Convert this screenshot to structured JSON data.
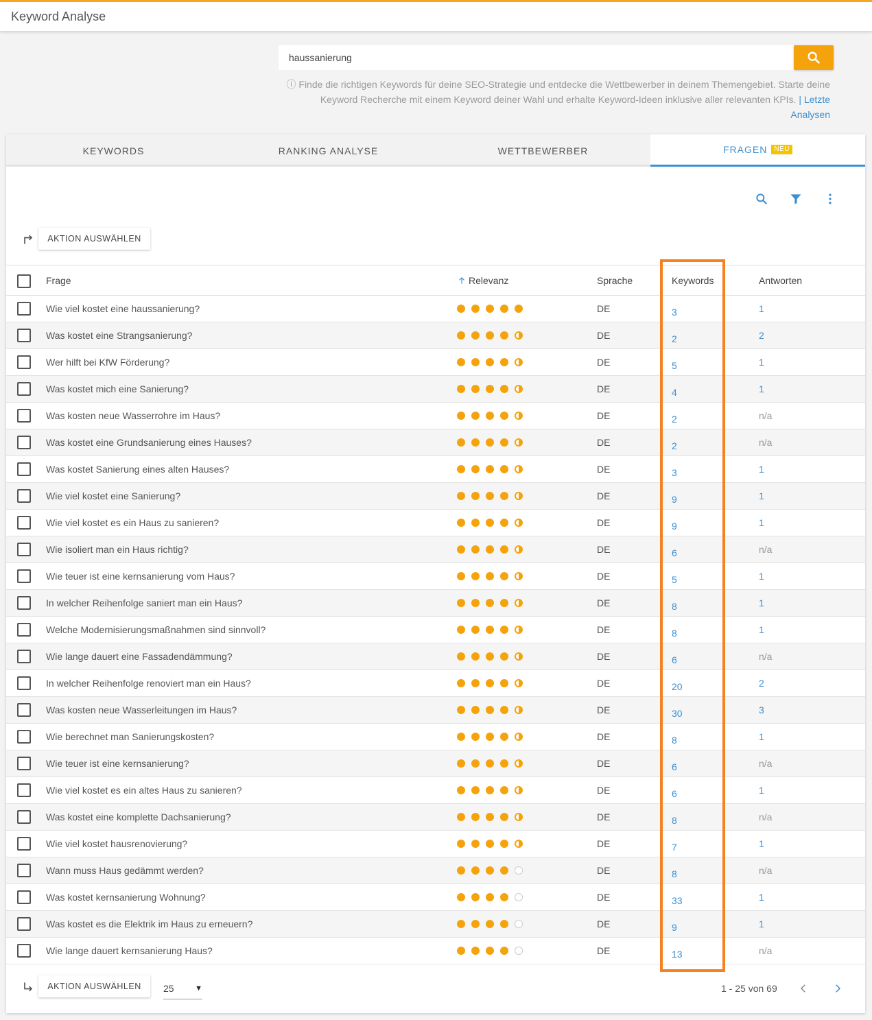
{
  "app": {
    "title": "Keyword Analyse"
  },
  "search": {
    "value": "haussanierung",
    "hint": "ⓘ Finde die richtigen Keywords für deine SEO-Strategie und entdecke die Wettbewerber in deinem Themengebiet. Starte deine Keyword Recherche mit einem Keyword deiner Wahl und erhalte Keyword-Ideen inklusive aller relevanten KPIs.",
    "hint_link": "| Letzte Analysen"
  },
  "tabs": [
    {
      "label": "KEYWORDS"
    },
    {
      "label": "RANKING ANALYSE"
    },
    {
      "label": "WETTBEWERBER"
    },
    {
      "label": "FRAGEN",
      "badge": "NEU",
      "active": true
    }
  ],
  "toolbar": {
    "action_label": "AKTION AUSWÄHLEN"
  },
  "table": {
    "headers": {
      "frage": "Frage",
      "relevanz": "Relevanz",
      "sprache": "Sprache",
      "keywords": "Keywords",
      "antworten": "Antworten"
    },
    "rows": [
      {
        "frage": "Wie viel kostet eine haussanierung?",
        "relevance": 5,
        "sprache": "DE",
        "keywords": "3",
        "antworten": "1"
      },
      {
        "frage": "Was kostet eine Strangsanierung?",
        "relevance": 4.5,
        "sprache": "DE",
        "keywords": "2",
        "antworten": "2"
      },
      {
        "frage": "Wer hilft bei KfW Förderung?",
        "relevance": 4.5,
        "sprache": "DE",
        "keywords": "5",
        "antworten": "1"
      },
      {
        "frage": "Was kostet mich eine Sanierung?",
        "relevance": 4.5,
        "sprache": "DE",
        "keywords": "4",
        "antworten": "1"
      },
      {
        "frage": "Was kosten neue Wasserrohre im Haus?",
        "relevance": 4.5,
        "sprache": "DE",
        "keywords": "2",
        "antworten": "n/a"
      },
      {
        "frage": "Was kostet eine Grundsanierung eines Hauses?",
        "relevance": 4.5,
        "sprache": "DE",
        "keywords": "2",
        "antworten": "n/a"
      },
      {
        "frage": "Was kostet Sanierung eines alten Hauses?",
        "relevance": 4.5,
        "sprache": "DE",
        "keywords": "3",
        "antworten": "1"
      },
      {
        "frage": "Wie viel kostet eine Sanierung?",
        "relevance": 4.5,
        "sprache": "DE",
        "keywords": "9",
        "antworten": "1"
      },
      {
        "frage": "Wie viel kostet es ein Haus zu sanieren?",
        "relevance": 4.5,
        "sprache": "DE",
        "keywords": "9",
        "antworten": "1"
      },
      {
        "frage": "Wie isoliert man ein Haus richtig?",
        "relevance": 4.5,
        "sprache": "DE",
        "keywords": "6",
        "antworten": "n/a"
      },
      {
        "frage": "Wie teuer ist eine kernsanierung vom Haus?",
        "relevance": 4.5,
        "sprache": "DE",
        "keywords": "5",
        "antworten": "1"
      },
      {
        "frage": "In welcher Reihenfolge saniert man ein Haus?",
        "relevance": 4.5,
        "sprache": "DE",
        "keywords": "8",
        "antworten": "1"
      },
      {
        "frage": "Welche Modernisierungsmaßnahmen sind sinnvoll?",
        "relevance": 4.5,
        "sprache": "DE",
        "keywords": "8",
        "antworten": "1"
      },
      {
        "frage": "Wie lange dauert eine Fassadendämmung?",
        "relevance": 4.5,
        "sprache": "DE",
        "keywords": "6",
        "antworten": "n/a"
      },
      {
        "frage": "In welcher Reihenfolge renoviert man ein Haus?",
        "relevance": 4.5,
        "sprache": "DE",
        "keywords": "20",
        "antworten": "2"
      },
      {
        "frage": "Was kosten neue Wasserleitungen im Haus?",
        "relevance": 4.5,
        "sprache": "DE",
        "keywords": "30",
        "antworten": "3"
      },
      {
        "frage": "Wie berechnet man Sanierungskosten?",
        "relevance": 4.5,
        "sprache": "DE",
        "keywords": "8",
        "antworten": "1"
      },
      {
        "frage": "Wie teuer ist eine kernsanierung?",
        "relevance": 4.5,
        "sprache": "DE",
        "keywords": "6",
        "antworten": "n/a"
      },
      {
        "frage": "Wie viel kostet es ein altes Haus zu sanieren?",
        "relevance": 4.5,
        "sprache": "DE",
        "keywords": "6",
        "antworten": "1"
      },
      {
        "frage": "Was kostet eine komplette Dachsanierung?",
        "relevance": 4.5,
        "sprache": "DE",
        "keywords": "8",
        "antworten": "n/a"
      },
      {
        "frage": "Wie viel kostet hausrenovierung?",
        "relevance": 4.5,
        "sprache": "DE",
        "keywords": "7",
        "antworten": "1"
      },
      {
        "frage": "Wann muss Haus gedämmt werden?",
        "relevance": 4,
        "sprache": "DE",
        "keywords": "8",
        "antworten": "n/a"
      },
      {
        "frage": "Was kostet kernsanierung Wohnung?",
        "relevance": 4,
        "sprache": "DE",
        "keywords": "33",
        "antworten": "1"
      },
      {
        "frage": "Was kostet es die Elektrik im Haus zu erneuern?",
        "relevance": 4,
        "sprache": "DE",
        "keywords": "9",
        "antworten": "1"
      },
      {
        "frage": "Wie lange dauert kernsanierung Haus?",
        "relevance": 4,
        "sprache": "DE",
        "keywords": "13",
        "antworten": "n/a"
      }
    ]
  },
  "footer": {
    "action_label": "AKTION AUSWÄHLEN",
    "page_size": "25",
    "page_info": "1 - 25 von 69"
  },
  "colors": {
    "accent": "#f5a30d",
    "link": "#3d8fd1",
    "highlight": "#f58220"
  }
}
